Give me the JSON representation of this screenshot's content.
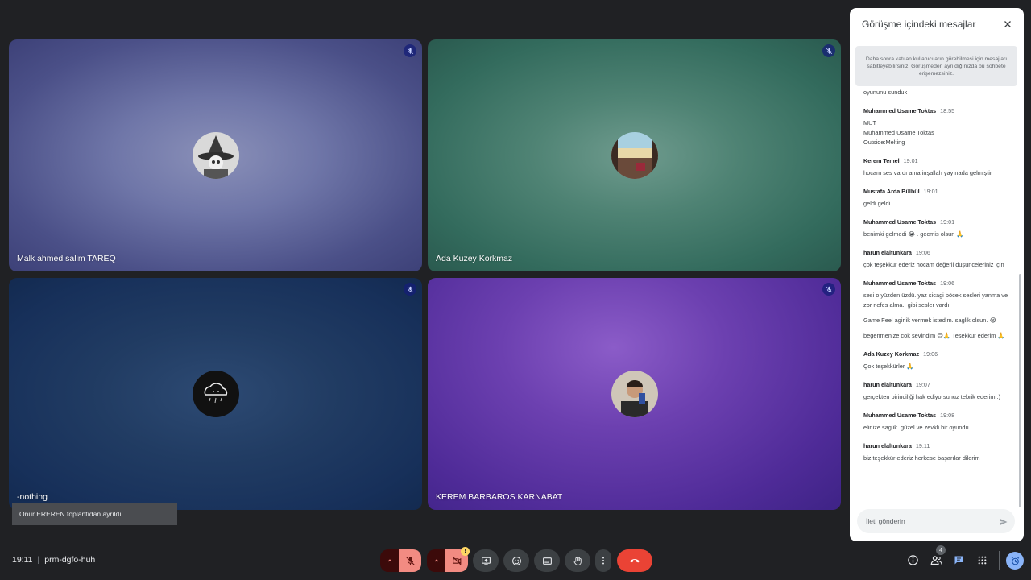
{
  "tiles": [
    {
      "name": "Malk ahmed salim TAREQ",
      "avatar_icon": "witch-cartoon-avatar-icon"
    },
    {
      "name": "Ada Kuzey Korkmaz",
      "avatar_icon": "landscape-photo-avatar-icon"
    },
    {
      "name": "-nothing",
      "avatar_icon": "rain-cloud-avatar-icon"
    },
    {
      "name": "KEREM BARBAROS KARNABAT",
      "avatar_icon": "person-photo-avatar-icon"
    }
  ],
  "toast": {
    "text": "Onur EREREN toplantıdan ayrıldı"
  },
  "meeting": {
    "time": "19:11",
    "separator": "|",
    "code": "prm-dgfo-huh"
  },
  "controls": {
    "camera_badge": "!",
    "people_count": "4"
  },
  "chat": {
    "title": "Görüşme içindeki mesajlar",
    "pinned_note": "Daha sonra katılan kullanıcıların görebilmesi için mesajları sabitleyebilirsiniz. Görüşmeden ayrıldığınızda bu sohbete erişemezsiniz.",
    "clipped_line": "oyununu sunduk",
    "messages": [
      {
        "sender": "Muhammed Usame Toktas",
        "time": "18:55",
        "lines": [
          "MUT",
          "Muhammed Usame Toktas",
          "Outside:Melting"
        ]
      },
      {
        "sender": "Kerem Temel",
        "time": "19:01",
        "lines": [
          "hocam ses vardı ama inşallah yayınada gelmiştir"
        ]
      },
      {
        "sender": "Mustafa Arda Bülbül",
        "time": "19:01",
        "lines": [
          "geldi geldi"
        ]
      },
      {
        "sender": "Muhammed Usame Toktas",
        "time": "19:01",
        "lines": [
          "benimki gelmedi 😭 . gecmis olsun 🙏"
        ]
      },
      {
        "sender": "harun elaltunkara",
        "time": "19:06",
        "lines": [
          "çok teşekkür ederiz hocam değerli düşünceleriniz için"
        ]
      },
      {
        "sender": "Muhammed Usame Toktas",
        "time": "19:06",
        "lines": [
          "sesi o yüzden üzdü. yaz sicagi böcek sesleri yanma ve zor nefes alma.. gibi sesler vardı.",
          "Game Feel agirlik vermek istedim. saglik olsun. 😭",
          "begenmenize cok sevindim 😊🙏 Tesekkür ederim 🙏"
        ]
      },
      {
        "sender": "Ada Kuzey Korkmaz",
        "time": "19:06",
        "lines": [
          "Çok teşekkürler 🙏"
        ]
      },
      {
        "sender": "harun elaltunkara",
        "time": "19:07",
        "lines": [
          "gerçekten birinciliği hak ediyorsunuz tebrik ederim :)"
        ]
      },
      {
        "sender": "Muhammed Usame Toktas",
        "time": "19:08",
        "lines": [
          "elinize saglik. güzel ve zevkli bir oyundu"
        ]
      },
      {
        "sender": "harun elaltunkara",
        "time": "19:11",
        "lines": [
          "biz teşekkür ederiz herkese başarılar dilerim"
        ]
      }
    ],
    "input_placeholder": "İleti gönderin"
  }
}
